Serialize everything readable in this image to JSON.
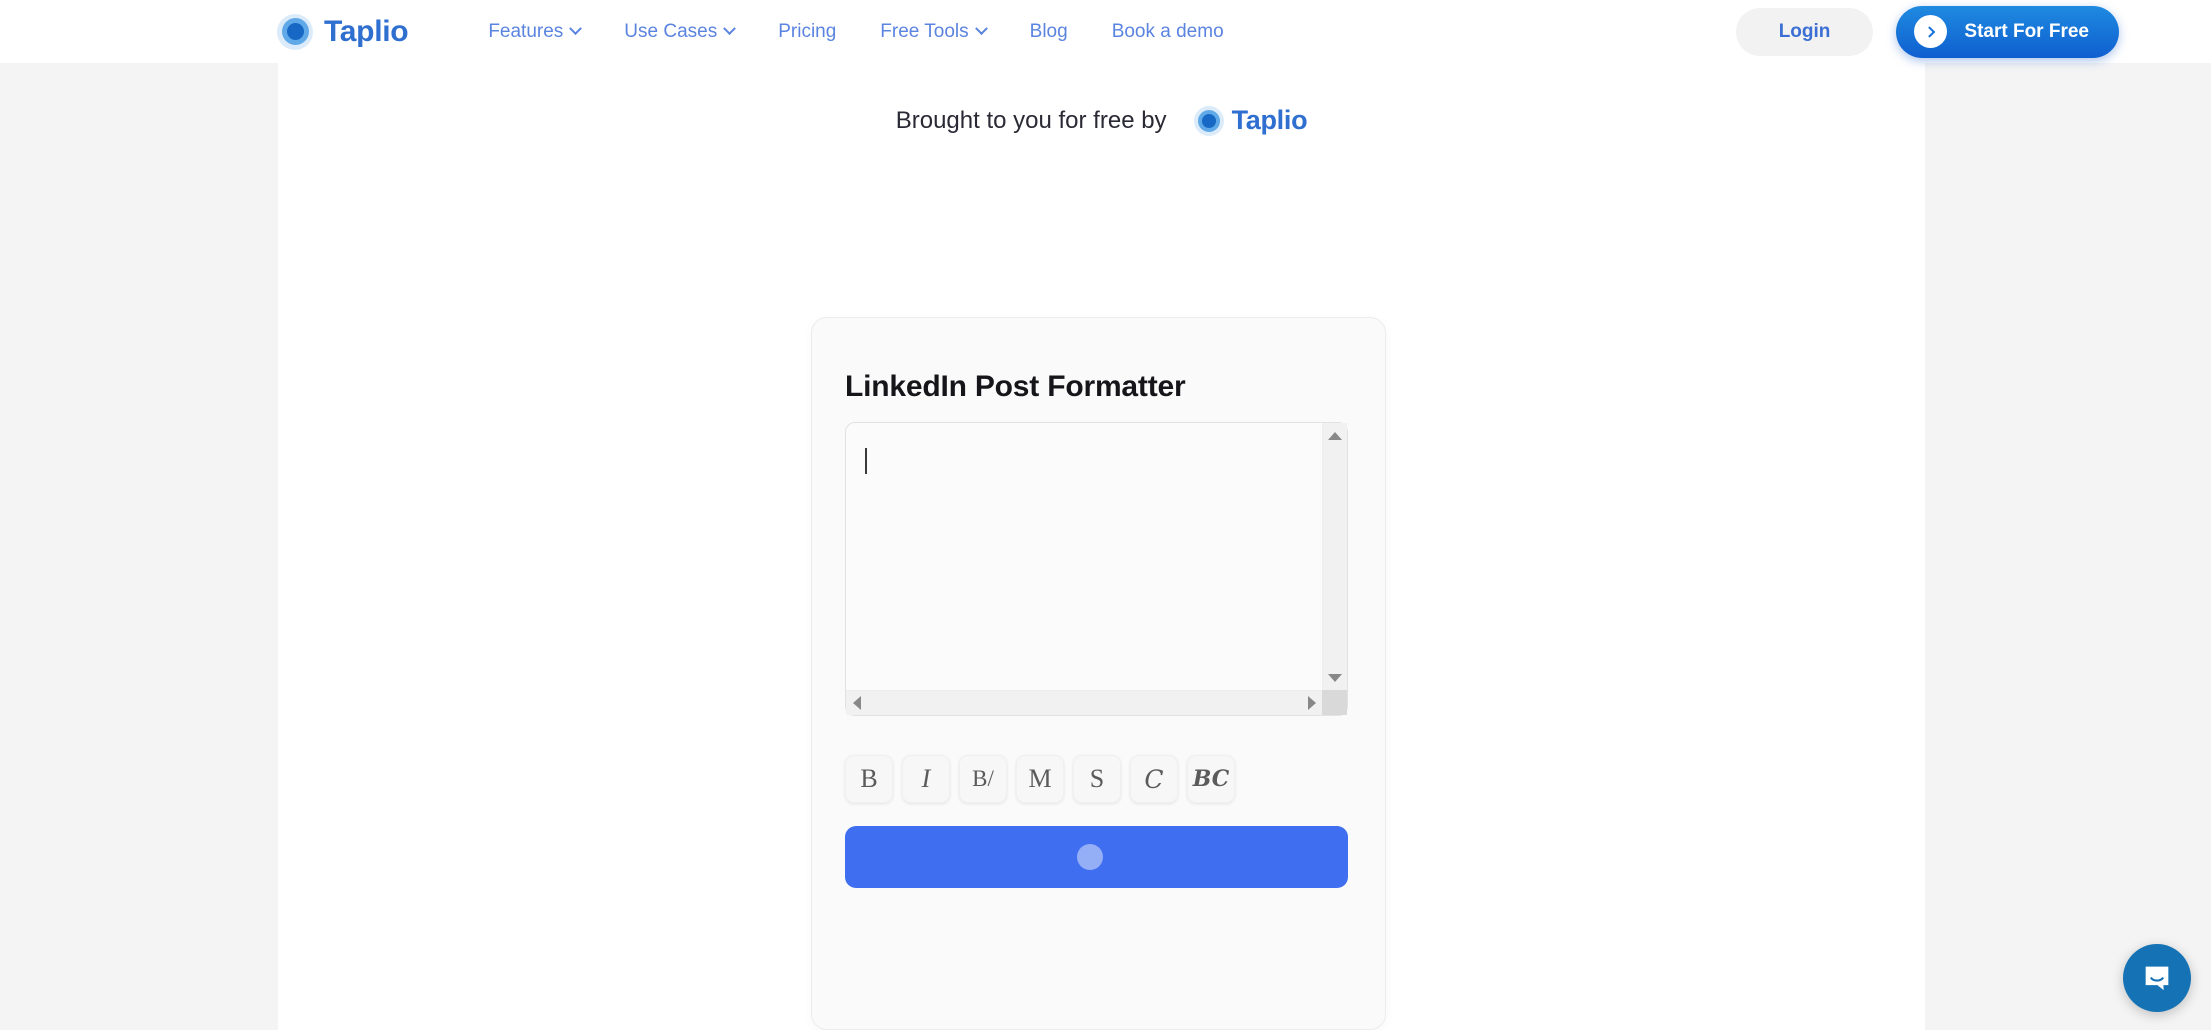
{
  "nav": {
    "brand": {
      "name": "Taplio",
      "logo_icon": "taplio-circles-logo"
    },
    "links": [
      {
        "label": "Features",
        "has_dropdown": true
      },
      {
        "label": "Use Cases",
        "has_dropdown": true
      },
      {
        "label": "Pricing",
        "has_dropdown": false
      },
      {
        "label": "Free Tools",
        "has_dropdown": true
      },
      {
        "label": "Blog",
        "has_dropdown": false
      },
      {
        "label": "Book a demo",
        "has_dropdown": false
      }
    ],
    "login_label": "Login",
    "start_label": "Start For Free",
    "start_icon": "arrow-right-circle-icon"
  },
  "banner": {
    "text": "Brought to you for free by",
    "brand_name": "Taplio"
  },
  "card": {
    "title": "LinkedIn Post Formatter",
    "editor": {
      "value": "",
      "placeholder": "",
      "caret_visible": true
    },
    "scrollbars": {
      "vertical_up": "scroll-up-arrow",
      "vertical_down": "scroll-down-arrow",
      "horizontal_left": "scroll-left-arrow",
      "horizontal_right": "scroll-right-arrow"
    },
    "toolbar": [
      {
        "label": "B",
        "name": "bold"
      },
      {
        "label": "I",
        "name": "italic"
      },
      {
        "label": "B/",
        "name": "bold-italic"
      },
      {
        "label": "M",
        "name": "monospace"
      },
      {
        "label": "S",
        "name": "sans-serif"
      },
      {
        "label": "C",
        "name": "cursive"
      },
      {
        "label": "BC",
        "name": "bold-cursive"
      }
    ],
    "cta_label": ""
  },
  "intercom": {
    "icon": "chat-bubble-icon"
  },
  "colors": {
    "page_background": "#f4f4f4",
    "content_background": "#ffffff",
    "nav_link": "#5b84e0",
    "brand_blue": "#2f6fd0",
    "cta_blue": "#3f6ef1",
    "start_gradient_top": "#1f8ae0",
    "start_gradient_bottom": "#0f5fd0",
    "intercom_blue": "#1573b5",
    "card_background": "#fafafa"
  }
}
